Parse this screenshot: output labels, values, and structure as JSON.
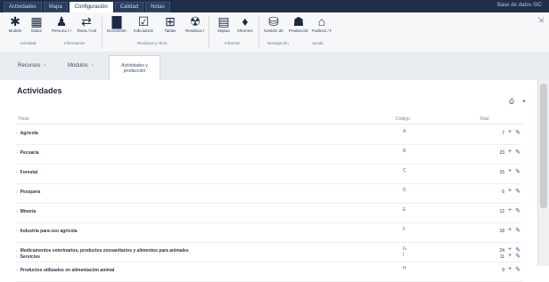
{
  "titlebar": {
    "tabs": [
      "Actividades",
      "Mapa",
      "Configuración",
      "Calidad",
      "Notas"
    ],
    "right_text": "Base de datos SIC"
  },
  "ribbon": {
    "buttons": [
      {
        "label": "Modelo",
        "icon": "✱"
      },
      {
        "label": "Datos",
        "icon": "▦"
      },
      {
        "label": "Persona / Actividad",
        "icon": "♟"
      },
      {
        "label": "Tarea / Actividad",
        "icon": "⇄"
      },
      {
        "label": "Documentos",
        "icon": "▇"
      },
      {
        "label": "Indicadores",
        "icon": "☑"
      },
      {
        "label": "Tablas",
        "icon": "⊞"
      },
      {
        "label": "Residuos / Otros",
        "icon": "☢"
      },
      {
        "label": "Mapas",
        "icon": "▤"
      },
      {
        "label": "Informes",
        "icon": "♦"
      },
      {
        "label": "Gestión de Inventario",
        "icon": "⛁"
      },
      {
        "label": "Producción / Proyecto",
        "icon": "☗"
      },
      {
        "label": "Publicar / Resultados",
        "icon": "⌂"
      }
    ],
    "groups": [
      "Actividad",
      "Información",
      "Residuos y otros",
      "Informes",
      "Navegación",
      "Ayuda"
    ],
    "collapse_icon": "⇲"
  },
  "breadcrumbs": [
    {
      "label": "Recursos"
    },
    {
      "label": "Módulos"
    },
    {
      "label": "Actividades y producción",
      "active": true
    }
  ],
  "page": {
    "title": "Actividades",
    "columns": {
      "name": "Título",
      "code": "Código",
      "total": "Total"
    }
  },
  "rows": [
    {
      "name": "Agrícola",
      "code": "A",
      "total": "7"
    },
    {
      "name": "Pecuaria",
      "code": "B",
      "total": "23"
    },
    {
      "name": "Forestal",
      "code": "C",
      "total": "15"
    },
    {
      "name": "Pesquera",
      "code": "D",
      "total": "6"
    },
    {
      "name": "Minería",
      "code": "E",
      "total": "12"
    },
    {
      "name": "Industria para uso agrícola",
      "code": "F",
      "total": "18"
    },
    {
      "name": "Medicamentos veterinarios, productos zoosanitarios y alimentos para animales",
      "code": "G",
      "total": "24"
    },
    {
      "name": "Productos utilizados en alimentación animal",
      "code": "H",
      "total": "9"
    },
    {
      "name": "Servicios",
      "code": "I",
      "total": "11"
    }
  ],
  "row_actions": {
    "add_icon": "+",
    "edit_icon": "✎"
  },
  "toolbar": {
    "print_icon": "⎙",
    "add_icon": "+"
  }
}
